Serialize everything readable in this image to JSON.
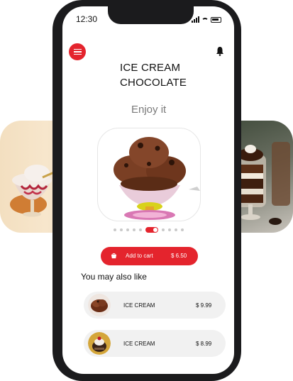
{
  "status_bar": {
    "time": "12:30"
  },
  "header": {
    "title_line1": "ICE CREAM",
    "title_line2": "CHOCOLATE",
    "subtitle": "Enjoy it"
  },
  "carousel": {
    "slides": [
      {
        "name": "vanilla-sundae-glass"
      },
      {
        "name": "chocolate-ice-cream-goblet"
      },
      {
        "name": "chocolate-parfait-jar"
      }
    ],
    "page_count": 10,
    "active_index": 5
  },
  "cart": {
    "label": "Add to cart",
    "price": "$ 6.50"
  },
  "recommendations": {
    "heading": "You may also like",
    "items": [
      {
        "name": "ICE CREAM",
        "price": "$ 9.99"
      },
      {
        "name": "ICE CREAM",
        "price": "$ 8.99"
      }
    ]
  },
  "colors": {
    "accent": "#e4242d",
    "frame": "#1b1b1d",
    "item_bg": "#f1f1f1"
  },
  "icons": [
    "menu-icon",
    "bell-icon",
    "cart-icon",
    "signal-icon",
    "wifi-icon",
    "battery-icon"
  ]
}
